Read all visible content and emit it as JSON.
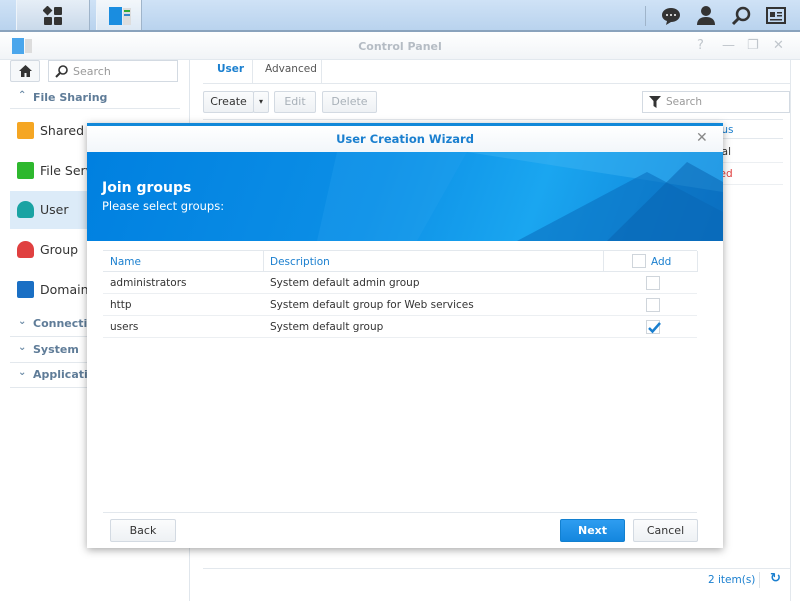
{
  "taskbar": {
    "icons": [
      "main-menu-icon",
      "control-panel-app-icon",
      "notifications-icon",
      "user-icon",
      "search-icon",
      "widgets-icon"
    ]
  },
  "window": {
    "title": "Control Panel",
    "controls": [
      "help-icon",
      "minimize-icon",
      "restore-icon",
      "close-icon"
    ]
  },
  "sidebar": {
    "search_placeholder": "Search",
    "section_file_sharing": "File Sharing",
    "items": [
      {
        "label": "Shared Folder",
        "icon": "shared-folder-icon",
        "color": "#f5a623"
      },
      {
        "label": "File Services",
        "icon": "file-services-icon",
        "color": "#2eb82e"
      },
      {
        "label": "User",
        "icon": "user-icon",
        "color": "#1aa3a3"
      },
      {
        "label": "Group",
        "icon": "group-icon",
        "color": "#e04040"
      },
      {
        "label": "Domain/LDAP",
        "icon": "domain-icon",
        "color": "#1a6fc4"
      }
    ],
    "sections": [
      "Connectivity",
      "System",
      "Applications"
    ]
  },
  "main": {
    "tabs": [
      {
        "label": "User",
        "active": true
      },
      {
        "label": "Advanced"
      }
    ],
    "toolbar": {
      "create": "Create",
      "edit": "Edit",
      "delete": "Delete",
      "search_placeholder": "Search"
    },
    "table": {
      "status_header": "Status",
      "statuses": [
        "Normal",
        "Disabled"
      ]
    },
    "footer": {
      "count": "2 item(s)"
    }
  },
  "dialog": {
    "title": "User Creation Wizard",
    "heading": "Join groups",
    "subheading": "Please select groups:",
    "columns": {
      "name": "Name",
      "description": "Description",
      "add": "Add"
    },
    "rows": [
      {
        "name": "administrators",
        "description": "System default admin group",
        "checked": false
      },
      {
        "name": "http",
        "description": "System default group for Web services",
        "checked": false
      },
      {
        "name": "users",
        "description": "System default group",
        "checked": true
      }
    ],
    "back": "Back",
    "next": "Next",
    "cancel": "Cancel"
  },
  "colors": {
    "accent": "#1288d8",
    "disabled_text": "#e03c3c"
  }
}
